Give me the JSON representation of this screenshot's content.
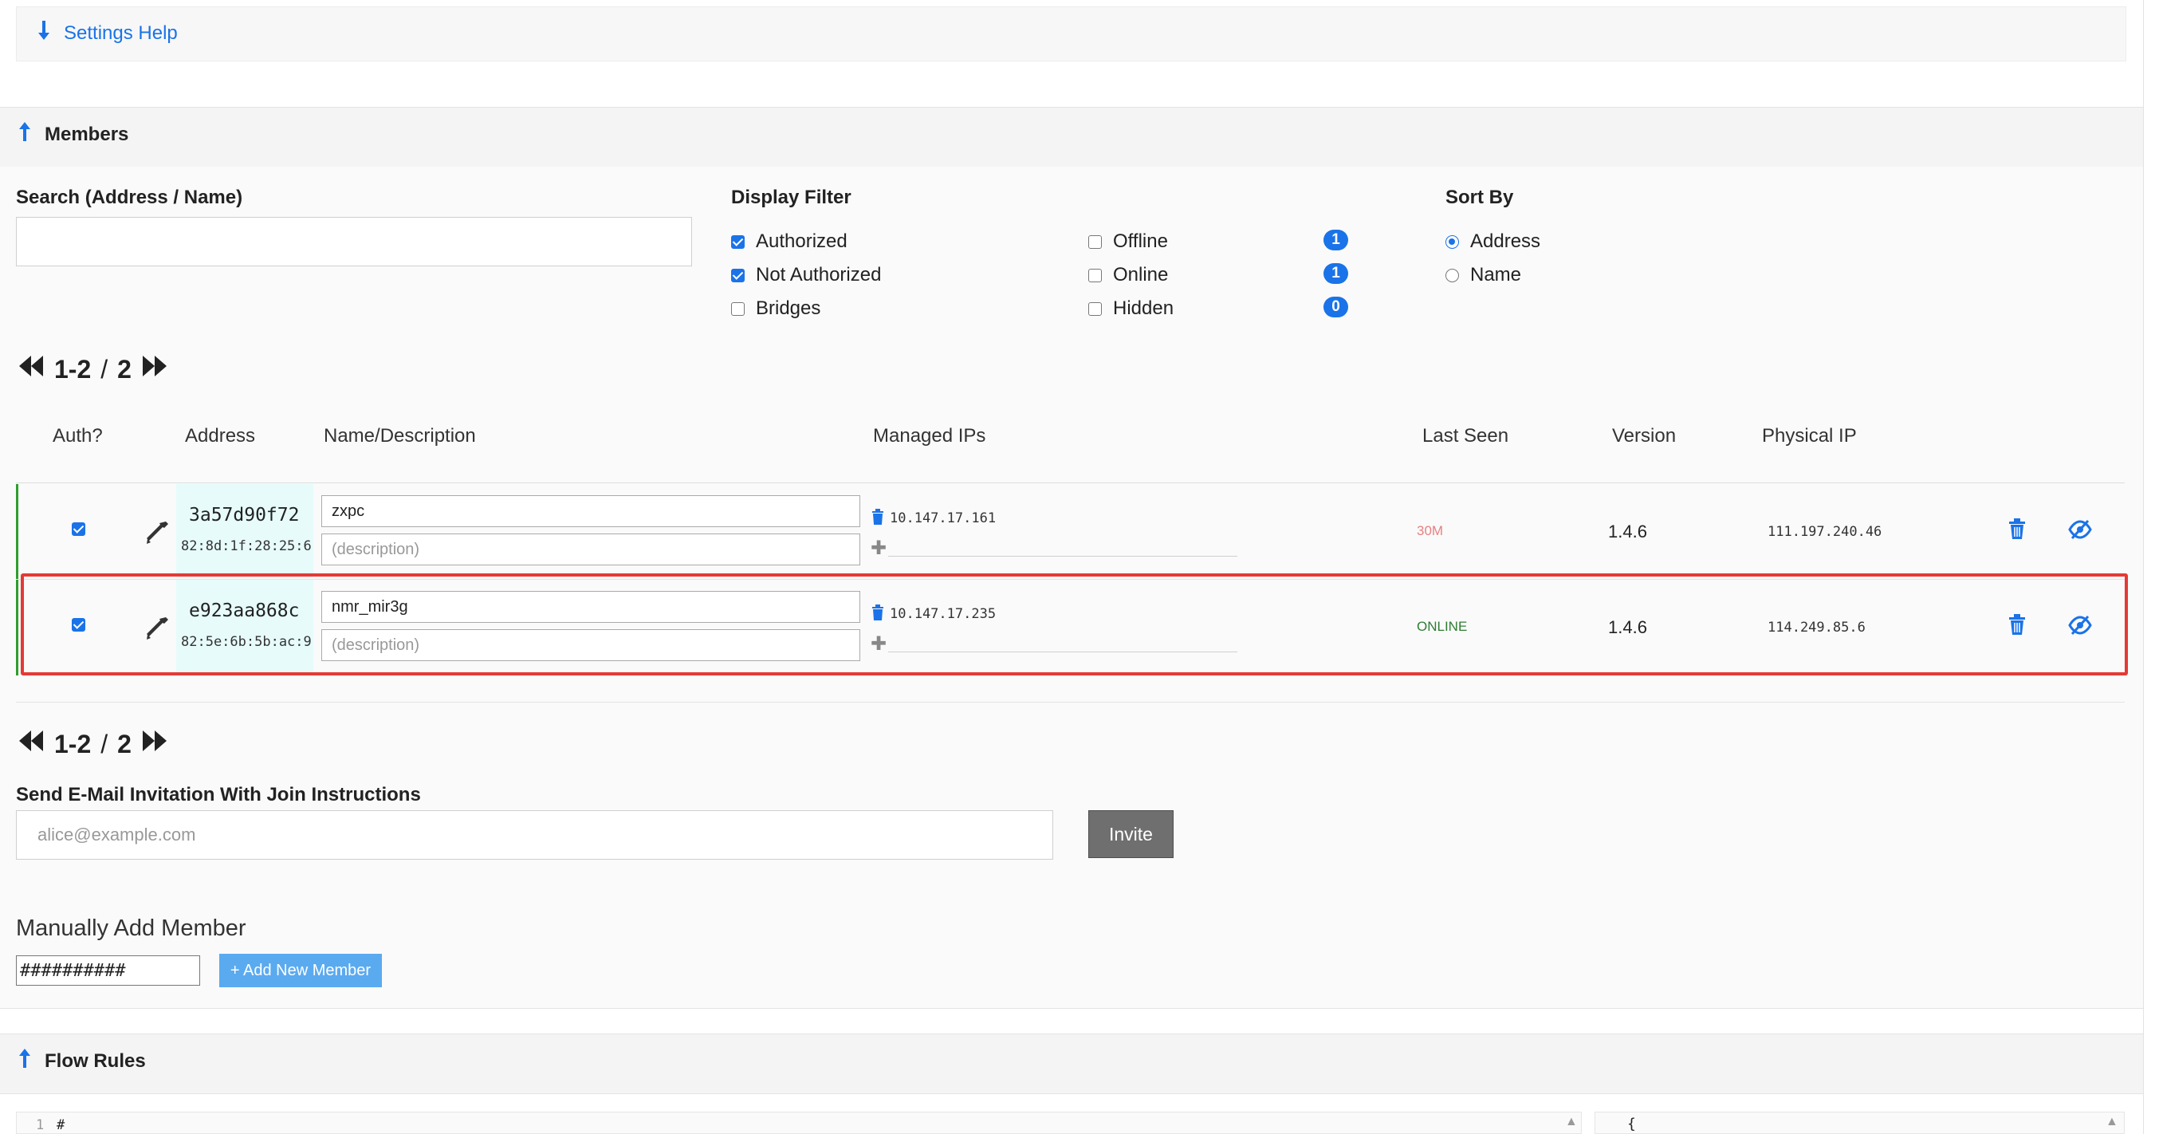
{
  "settings_help": {
    "label": "Settings Help"
  },
  "members": {
    "title": "Members",
    "search_label": "Search (Address / Name)",
    "search_value": "",
    "display_filter": {
      "label": "Display Filter",
      "left": [
        {
          "label": "Authorized",
          "checked": true
        },
        {
          "label": "Not Authorized",
          "checked": true
        },
        {
          "label": "Bridges",
          "checked": false
        }
      ],
      "right": [
        {
          "label": "Offline",
          "checked": false,
          "count": "1"
        },
        {
          "label": "Online",
          "checked": false,
          "count": "1"
        },
        {
          "label": "Hidden",
          "checked": false,
          "count": "0"
        }
      ]
    },
    "sort_by": {
      "label": "Sort By",
      "options": [
        {
          "label": "Address",
          "selected": true
        },
        {
          "label": "Name",
          "selected": false
        }
      ]
    },
    "pager": {
      "range": "1-2",
      "separator": "/",
      "total": "2"
    },
    "columns": {
      "auth": "Auth?",
      "address": "Address",
      "name": "Name/Description",
      "managed_ips": "Managed IPs",
      "last_seen": "Last Seen",
      "version": "Version",
      "physical_ip": "Physical IP"
    },
    "rows": [
      {
        "authorized": true,
        "address": "3a57d90f72",
        "mac": "82:8d:1f:28:25:6",
        "name": "zxpc",
        "description_placeholder": "(description)",
        "managed_ip": "10.147.17.161",
        "last_seen": "30M",
        "last_seen_color": "#e88080",
        "version": "1.4.6",
        "physical_ip": "111.197.240.46"
      },
      {
        "authorized": true,
        "address": "e923aa868c",
        "mac": "82:5e:6b:5b:ac:9",
        "name": "nmr_mir3g",
        "description_placeholder": "(description)",
        "managed_ip": "10.147.17.235",
        "last_seen": "ONLINE",
        "last_seen_color": "#2e7d32",
        "version": "1.4.6",
        "physical_ip": "114.249.85.6"
      }
    ],
    "invite": {
      "label": "Send E-Mail Invitation With Join Instructions",
      "placeholder": "alice@example.com",
      "button": "Invite"
    },
    "manual_add": {
      "label": "Manually Add Member",
      "value": "##########",
      "button": "+ Add New Member"
    }
  },
  "flow_rules": {
    "title": "Flow Rules",
    "line_number": "1",
    "left_text": "#",
    "right_text": "{"
  },
  "colors": {
    "accent": "#1a73e8",
    "authorized_border": "#2e9e2e",
    "highlight": "#e53935",
    "address_bg": "#e7fbfb"
  }
}
